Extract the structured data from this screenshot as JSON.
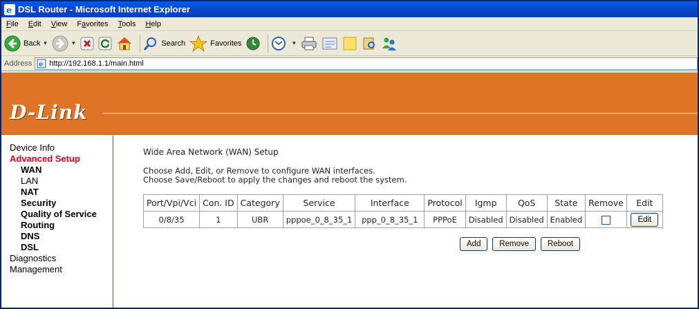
{
  "window": {
    "title": "DSL Router - Microsoft Internet Explorer"
  },
  "menu": [
    {
      "label": "File",
      "key": "F"
    },
    {
      "label": "Edit",
      "key": "E"
    },
    {
      "label": "View",
      "key": "V"
    },
    {
      "label": "Favorites",
      "key": "a"
    },
    {
      "label": "Tools",
      "key": "T"
    },
    {
      "label": "Help",
      "key": "H"
    }
  ],
  "toolbar": {
    "back_label": "Back",
    "search_label": "Search",
    "favorites_label": "Favorites"
  },
  "address": {
    "label": "Address",
    "url": "http://192.168.1.1/main.html"
  },
  "banner": {
    "logo": "D-Link"
  },
  "sidebar": {
    "items": [
      {
        "label": "Device Info"
      },
      {
        "label": "Advanced Setup"
      },
      {
        "label": "WAN"
      },
      {
        "label": "LAN"
      },
      {
        "label": "NAT"
      },
      {
        "label": "Security"
      },
      {
        "label": "Quality of Service"
      },
      {
        "label": "Routing"
      },
      {
        "label": "DNS"
      },
      {
        "label": "DSL"
      },
      {
        "label": "Diagnostics"
      },
      {
        "label": "Management"
      }
    ]
  },
  "main": {
    "heading": "Wide Area Network (WAN) Setup",
    "desc1": "Choose Add, Edit, or Remove to configure WAN interfaces.",
    "desc2": "Choose Save/Reboot to apply the changes and reboot the system.",
    "table": {
      "headers": [
        "Port/Vpi/Vci",
        "Con. ID",
        "Category",
        "Service",
        "Interface",
        "Protocol",
        "Igmp",
        "QoS",
        "State",
        "Remove",
        "Edit"
      ],
      "row": [
        "0/8/35",
        "1",
        "UBR",
        "pppoe_0_8_35_1",
        "ppp_0_8_35_1",
        "PPPoE",
        "Disabled",
        "Disabled",
        "Enabled"
      ],
      "edit_label": "Edit"
    },
    "buttons": {
      "add": "Add",
      "remove": "Remove",
      "reboot": "Reboot"
    }
  }
}
